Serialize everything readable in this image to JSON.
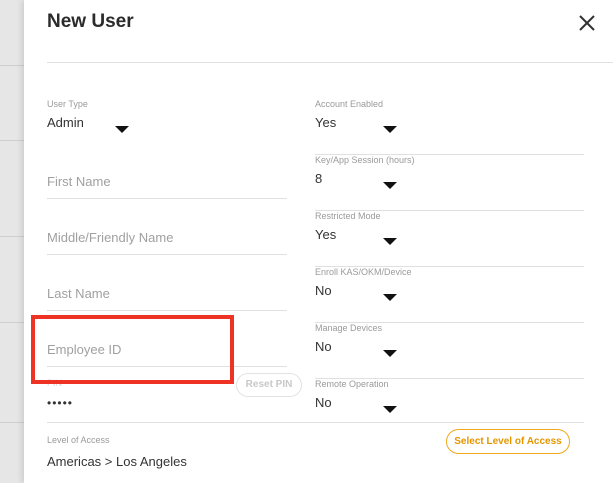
{
  "dialog": {
    "title": "New User",
    "close_icon": "close-icon"
  },
  "left_column": {
    "user_type": {
      "label": "User Type",
      "value": "Admin"
    },
    "first_name": {
      "placeholder": "First Name"
    },
    "middle_name": {
      "placeholder": "Middle/Friendly Name"
    },
    "last_name": {
      "placeholder": "Last Name"
    },
    "employee_id": {
      "placeholder": "Employee ID"
    },
    "pin": {
      "label": "PIN",
      "value": "•••••",
      "reset_label": "Reset PIN"
    }
  },
  "right_column": {
    "account_enabled": {
      "label": "Account Enabled",
      "value": "Yes"
    },
    "session": {
      "label": "Key/App Session (hours)",
      "value": "8"
    },
    "restricted_mode": {
      "label": "Restricted Mode",
      "value": "Yes"
    },
    "enroll": {
      "label": "Enroll KAS/OKM/Device",
      "value": "No"
    },
    "manage_devices": {
      "label": "Manage Devices",
      "value": "No"
    },
    "remote_operation": {
      "label": "Remote Operation",
      "value": "No"
    }
  },
  "access": {
    "label": "Level of Access",
    "value": "Americas > Los Angeles",
    "button_label": "Select Level of Access"
  },
  "colors": {
    "accent": "#f0a81c",
    "highlight": "#ee3224"
  }
}
